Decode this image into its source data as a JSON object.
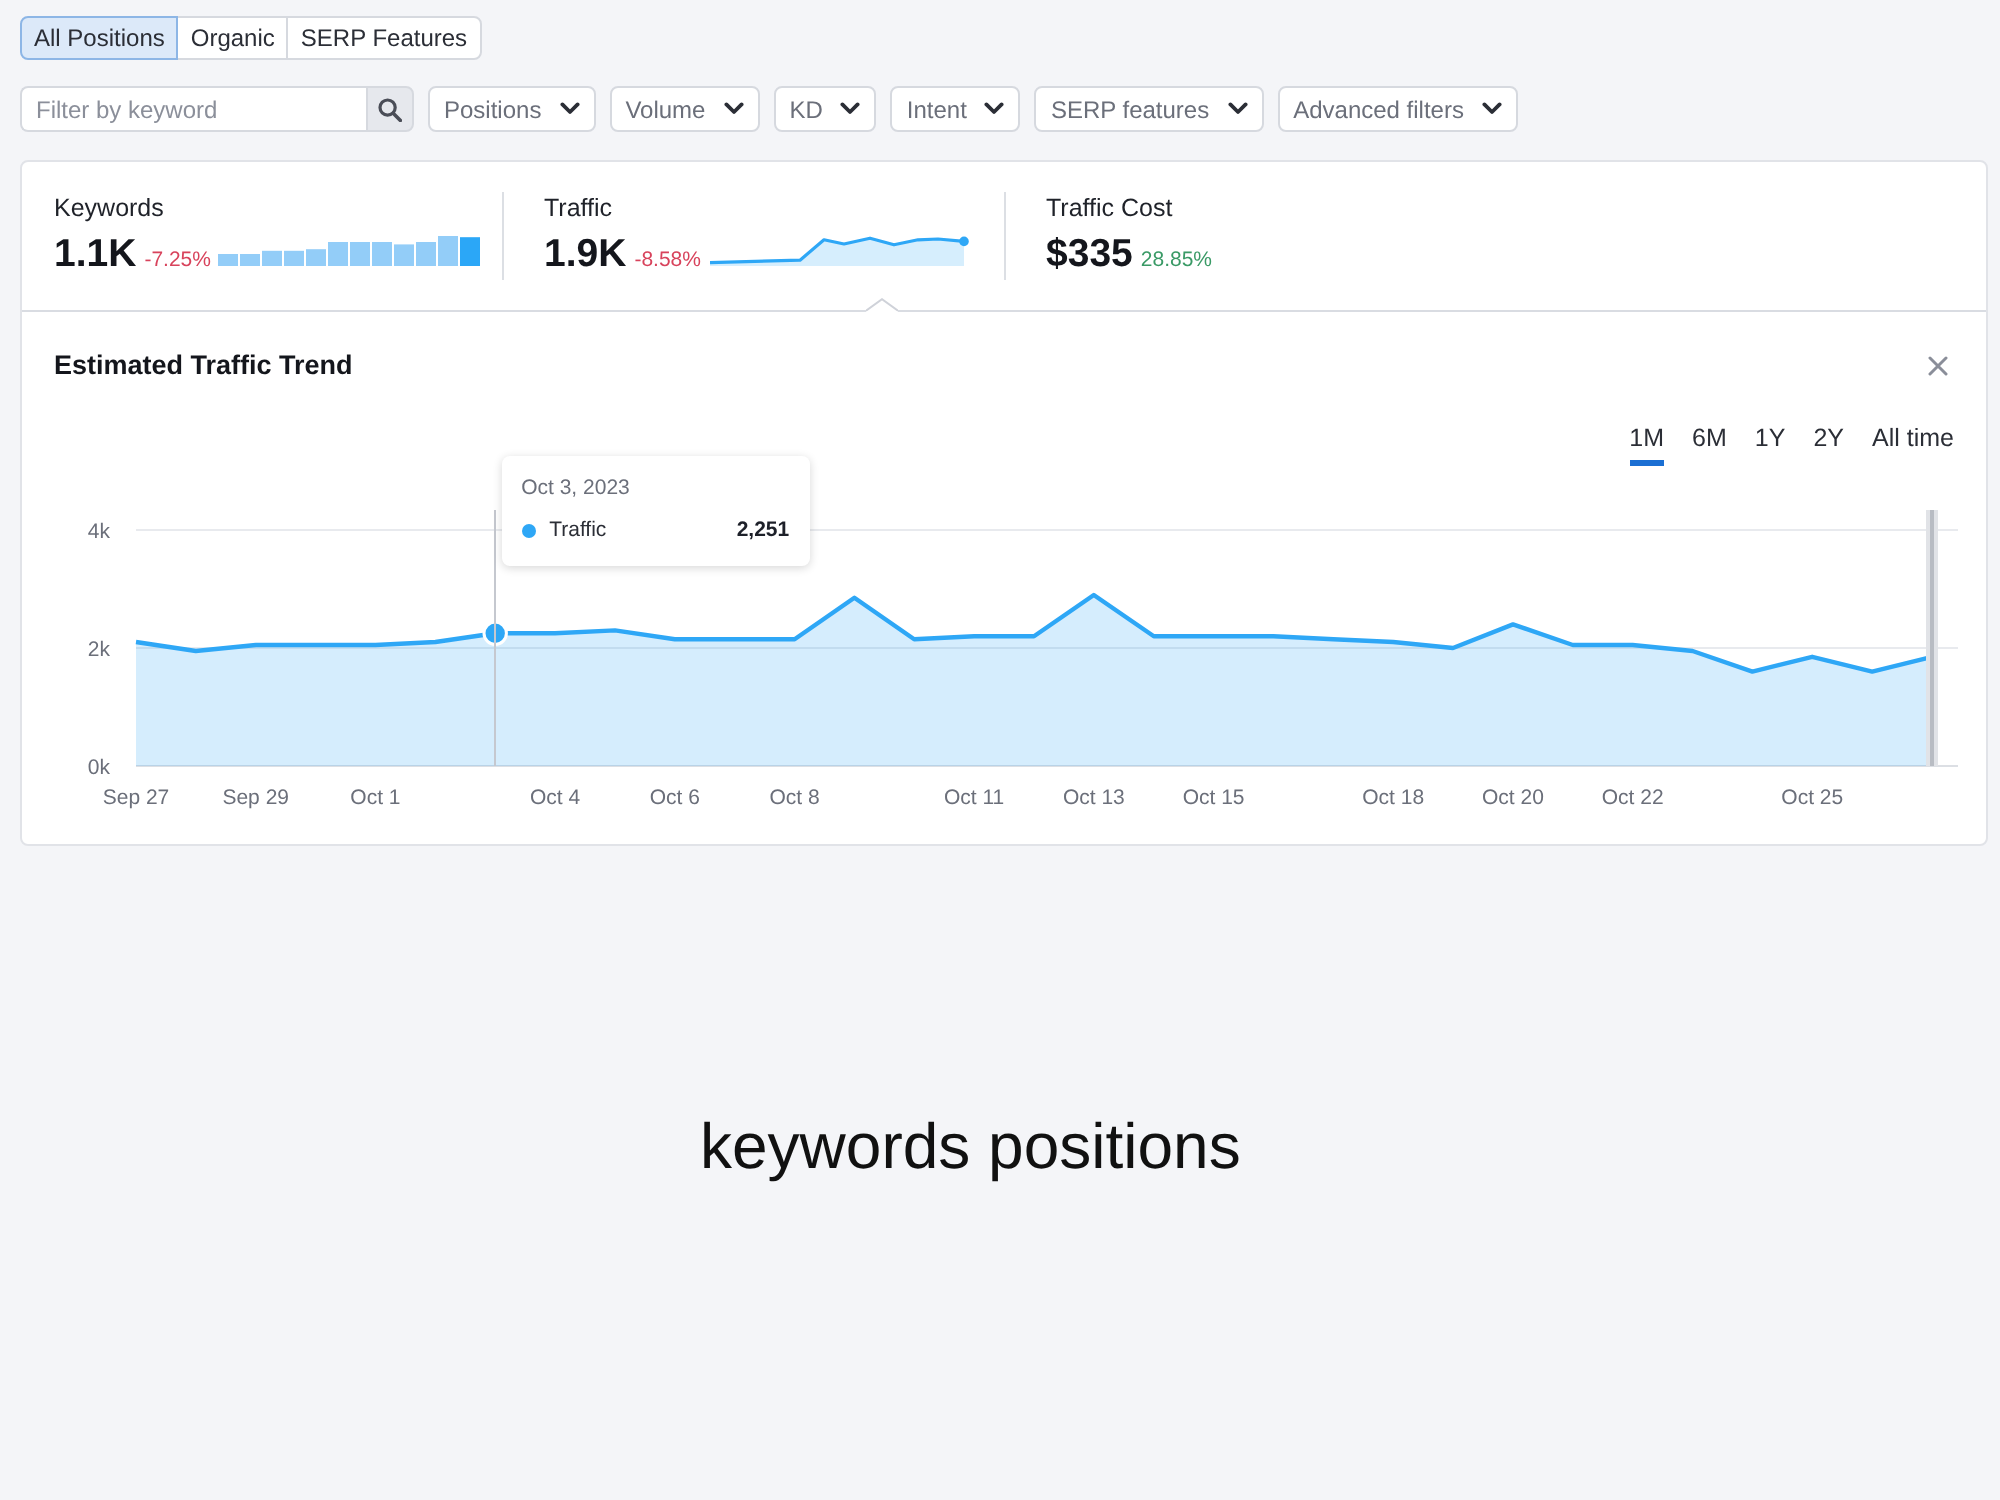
{
  "view_tabs": [
    {
      "label": "All Positions",
      "selected": true
    },
    {
      "label": "Organic",
      "selected": false
    },
    {
      "label": "SERP Features",
      "selected": false
    }
  ],
  "search": {
    "placeholder": "Filter by keyword"
  },
  "filters": [
    "Positions",
    "Volume",
    "KD",
    "Intent",
    "SERP features",
    "Advanced filters"
  ],
  "metrics": [
    {
      "label": "Keywords",
      "value": "1.1K",
      "change": {
        "text": "-7.25%",
        "color": "#d8435c"
      },
      "kind": "bars",
      "selected": false
    },
    {
      "label": "Traffic",
      "value": "1.9K",
      "change": {
        "text": "-8.58%",
        "color": "#d8435c"
      },
      "kind": "line",
      "selected": true
    },
    {
      "label": "Traffic Cost",
      "value": "$335",
      "change": {
        "text": "28.85%",
        "color": "#3a9a66"
      },
      "kind": "plain",
      "selected": false
    }
  ],
  "trend": {
    "title": "Estimated Traffic Trend",
    "periods": [
      {
        "label": "1M",
        "selected": true
      },
      {
        "label": "6M",
        "selected": false
      },
      {
        "label": "1Y",
        "selected": false
      },
      {
        "label": "2Y",
        "selected": false
      },
      {
        "label": "All time",
        "selected": false
      }
    ],
    "chart_data": {
      "type": "area",
      "categories": [
        "Sep 27",
        null,
        "Sep 29",
        null,
        "Oct 1",
        null,
        null,
        "Oct 4",
        null,
        "Oct 6",
        null,
        "Oct 8",
        null,
        null,
        "Oct 11",
        null,
        "Oct 13",
        null,
        "Oct 15",
        null,
        null,
        "Oct 18",
        null,
        "Oct 20",
        null,
        "Oct 22",
        null,
        null,
        "Oct 25",
        null,
        null
      ],
      "series": [
        {
          "name": "Traffic",
          "color": "#2ea7f6",
          "values": [
            2100,
            1950,
            2050,
            2050,
            2050,
            2100,
            2250,
            2250,
            2300,
            2150,
            2150,
            2150,
            2850,
            2150,
            2200,
            2200,
            2900,
            2200,
            2200,
            2200,
            2150,
            2100,
            2000,
            2400,
            2050,
            2050,
            1950,
            1600,
            1850,
            1600,
            1850
          ]
        }
      ],
      "ylim": [
        0,
        4000
      ],
      "yticks": [
        {
          "value": 0,
          "label": "0k"
        },
        {
          "value": 2000,
          "label": "2k"
        },
        {
          "value": 4000,
          "label": "4k"
        }
      ]
    },
    "cursor": {
      "level": 0.2
    },
    "tooltip": {
      "date": "Oct 3, 2023",
      "value": "2,251"
    }
  },
  "caption": "keywords positions"
}
